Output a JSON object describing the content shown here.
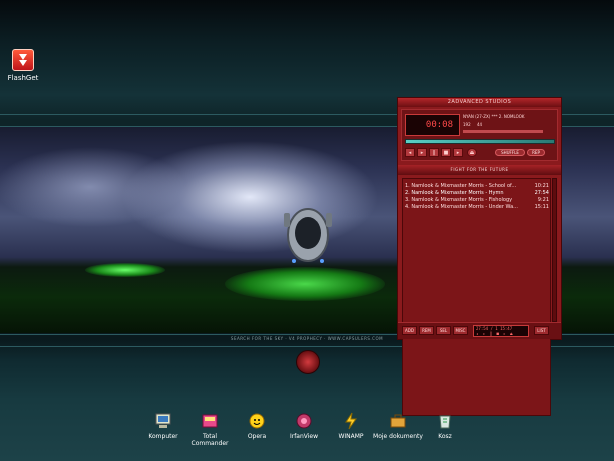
{
  "desktop_icons": [
    {
      "label": "FlashGet",
      "icon": "flashget-icon"
    }
  ],
  "wallpaper": {
    "caption": "SEARCH FOR THE SKY · V4 PROPHECY · WWW.CAPSULERS.COM"
  },
  "winamp": {
    "title": "2ADVANCED STUDIOS",
    "time_display": "00:08",
    "track_info": "NYAN (27-ZX) *** 2. NOMLOOK",
    "bitrate": "192",
    "khz": "44",
    "shuffle_label": "SHUFFLE",
    "repeat_label": "REP",
    "playlist_title": "FIGHT FOR THE FUTURE",
    "tracks": [
      {
        "title": "1. Namlook & Mixmaster Morris - School of...",
        "time": "10:21"
      },
      {
        "title": "2. Namlook & Mixmaster Morris - Hymn",
        "time": "27:54"
      },
      {
        "title": "3. Namlook & Mixmaster Morris - Fishology",
        "time": "9:21"
      },
      {
        "title": "4. Namlook & Mixmaster Morris - Under Wa...",
        "time": "15:11"
      }
    ],
    "footer_display": "27:54 / 1 15:47",
    "footer_buttons": [
      "ADD",
      "REM",
      "SEL",
      "MISC",
      "LIST"
    ]
  },
  "bottom_icons": [
    {
      "label": "Komputer",
      "icon": "computer-icon"
    },
    {
      "label": "Total Commander",
      "icon": "total-commander-icon"
    },
    {
      "label": "Opera",
      "icon": "opera-icon"
    },
    {
      "label": "IrfanView",
      "icon": "irfanview-icon"
    },
    {
      "label": "WINAMP",
      "icon": "winamp-icon"
    },
    {
      "label": "Moje dokumenty",
      "icon": "briefcase-icon"
    },
    {
      "label": "Kosz",
      "icon": "recycle-bin-icon"
    }
  ],
  "colors": {
    "winamp_body": "#8a1a1d",
    "lcd_text": "#ff4a4a",
    "seek_bar": "#5ad0c6"
  }
}
